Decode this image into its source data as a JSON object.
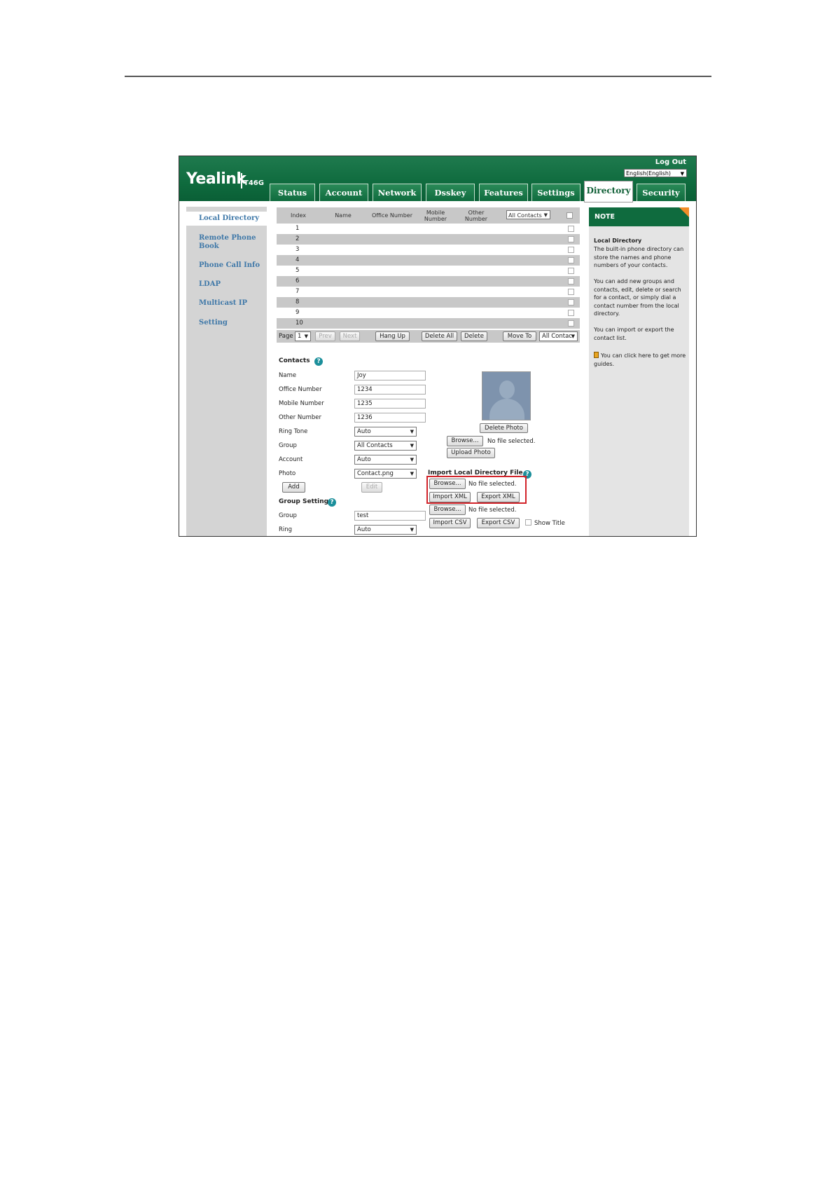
{
  "header": {
    "logo": "Yealink",
    "model": "T46G",
    "logout": "Log Out",
    "language": "English(English)"
  },
  "tabs": [
    "Status",
    "Account",
    "Network",
    "Dsskey",
    "Features",
    "Settings",
    "Directory",
    "Security"
  ],
  "active_tab": "Directory",
  "sidebar": {
    "items": [
      "Local Directory",
      "Remote Phone Book",
      "Phone Call Info",
      "LDAP",
      "Multicast IP",
      "Setting"
    ],
    "active": "Local Directory"
  },
  "table": {
    "headers": {
      "index": "Index",
      "name": "Name",
      "office": "Office Number",
      "mobile": "Mobile Number",
      "other": "Other Number"
    },
    "filter": "All Contacts",
    "rows": [
      "1",
      "2",
      "3",
      "4",
      "5",
      "6",
      "7",
      "8",
      "9",
      "10"
    ]
  },
  "pager": {
    "page_label": "Page",
    "page": "1",
    "prev": "Prev",
    "next": "Next",
    "hang_up": "Hang Up",
    "delete_all": "Delete All",
    "delete": "Delete",
    "move_to": "Move To",
    "move_target": "All Contac"
  },
  "contacts": {
    "title": "Contacts",
    "fields": {
      "name": {
        "label": "Name",
        "value": "Joy"
      },
      "office": {
        "label": "Office Number",
        "value": "1234"
      },
      "mobile": {
        "label": "Mobile Number",
        "value": "1235"
      },
      "other": {
        "label": "Other Number",
        "value": "1236"
      },
      "ring": {
        "label": "Ring Tone",
        "value": "Auto"
      },
      "group": {
        "label": "Group",
        "value": "All Contacts"
      },
      "account": {
        "label": "Account",
        "value": "Auto"
      },
      "photo": {
        "label": "Photo",
        "value": "Contact.png"
      }
    },
    "add": "Add",
    "edit": "Edit",
    "delete_photo": "Delete Photo",
    "browse": "Browse...",
    "no_file": "No file selected.",
    "upload_photo": "Upload Photo"
  },
  "import": {
    "title": "Import Local Directory File",
    "browse": "Browse...",
    "no_file": "No file selected.",
    "import_xml": "Import XML",
    "export_xml": "Export XML",
    "browse2": "Browse...",
    "no_file2": "No file selected.",
    "import_csv": "Import CSV",
    "export_csv": "Export CSV",
    "show_title": "Show Title"
  },
  "group_setting": {
    "title": "Group Setting",
    "group_label": "Group",
    "group_value": "test",
    "ring_label": "Ring",
    "ring_value": "Auto"
  },
  "note": {
    "title": "NOTE",
    "heading": "Local Directory",
    "p1": "The built-in phone directory can store the names and phone numbers of your contacts.",
    "p2": "You can add new groups and contacts, edit, delete or search for a contact, or simply dial a contact number from the local directory.",
    "p3": "You can import or export the contact list.",
    "p4": "You can click here to get more guides."
  }
}
